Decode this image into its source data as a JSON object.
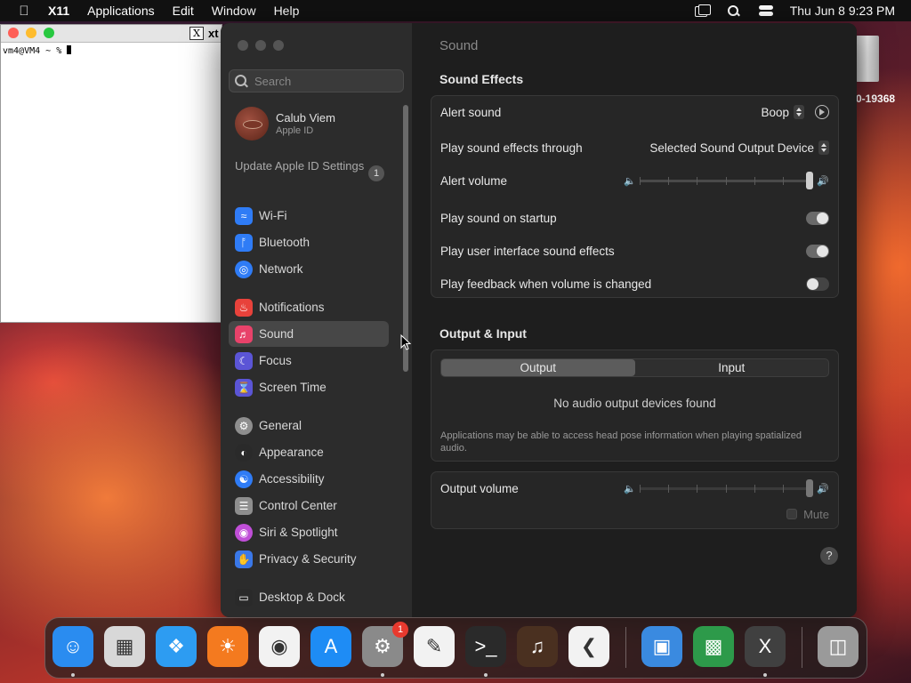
{
  "menubar": {
    "app_name": "X11",
    "menus": [
      "Applications",
      "Edit",
      "Window",
      "Help"
    ],
    "datetime": "Thu Jun 8  9:23 PM"
  },
  "xterm": {
    "title": "xt",
    "x_logo": "X",
    "prompt": "vm4@VM4 ~ % "
  },
  "desktop": {
    "disk_label": "0-19368"
  },
  "sidebar": {
    "search_placeholder": "Search",
    "account": {
      "name": "Calub Viem",
      "subtitle": "Apple ID"
    },
    "update_text": "Update Apple ID Settings",
    "update_badge": "1",
    "items": [
      {
        "label": "Wi-Fi",
        "icon": "wifi-icon",
        "color": "#2f7cf6"
      },
      {
        "label": "Bluetooth",
        "icon": "bluetooth-icon",
        "color": "#2f7cf6"
      },
      {
        "label": "Network",
        "icon": "globe-icon",
        "color": "#2f7cf6"
      },
      {
        "label": "Notifications",
        "icon": "bell-icon",
        "color": "#e8423b"
      },
      {
        "label": "Sound",
        "icon": "speaker-icon",
        "color": "#e8426a"
      },
      {
        "label": "Focus",
        "icon": "moon-icon",
        "color": "#5b55d6"
      },
      {
        "label": "Screen Time",
        "icon": "hourglass-icon",
        "color": "#5b55d6"
      },
      {
        "label": "General",
        "icon": "gear-icon",
        "color": "#8e8e8e"
      },
      {
        "label": "Appearance",
        "icon": "appearance-icon",
        "color": "#2a2a2a"
      },
      {
        "label": "Accessibility",
        "icon": "accessibility-icon",
        "color": "#2f7cf6"
      },
      {
        "label": "Control Center",
        "icon": "control-center-icon",
        "color": "#8e8e8e"
      },
      {
        "label": "Siri & Spotlight",
        "icon": "siri-icon",
        "color": "#c04fd8"
      },
      {
        "label": "Privacy & Security",
        "icon": "hand-icon",
        "color": "#3a78e8"
      },
      {
        "label": "Desktop & Dock",
        "icon": "dock-icon",
        "color": "#2a2a2a"
      }
    ],
    "selected": "Sound"
  },
  "content": {
    "page_title": "Sound",
    "sound_effects": {
      "section_title": "Sound Effects",
      "alert_sound_label": "Alert sound",
      "alert_sound_value": "Boop",
      "play_through_label": "Play sound effects through",
      "play_through_value": "Selected Sound Output Device",
      "alert_volume_label": "Alert volume",
      "alert_volume_level": 1.0,
      "startup_label": "Play sound on startup",
      "startup_on": true,
      "ui_effects_label": "Play user interface sound effects",
      "ui_effects_on": true,
      "feedback_label": "Play feedback when volume is changed",
      "feedback_on": false
    },
    "output_input": {
      "section_title": "Output & Input",
      "tabs": [
        "Output",
        "Input"
      ],
      "active_tab": "Output",
      "no_devices": "No audio output devices found",
      "note": "Applications may be able to access head pose information when playing spatialized audio."
    },
    "output_volume": {
      "label": "Output volume",
      "level": 1.0,
      "mute_label": "Mute"
    },
    "help": "?"
  },
  "dock": {
    "apps": [
      {
        "name": "Finder",
        "icon": "finder-icon",
        "running": true,
        "color": "#2a8cf0"
      },
      {
        "name": "Launchpad",
        "icon": "launchpad-icon",
        "running": false,
        "color": "#d8d8d8"
      },
      {
        "name": "Safari",
        "icon": "safari-icon",
        "running": false,
        "color": "#2d9cf2"
      },
      {
        "name": "Firefox",
        "icon": "firefox-icon",
        "running": false,
        "color": "#f47a1f"
      },
      {
        "name": "Chrome",
        "icon": "chrome-icon",
        "running": false,
        "color": "#f2f2f2"
      },
      {
        "name": "App Store",
        "icon": "app-store-icon",
        "running": false,
        "color": "#1e8cf5"
      },
      {
        "name": "System Settings",
        "icon": "system-settings-icon",
        "running": true,
        "badge": "1",
        "color": "#8a8a8a"
      },
      {
        "name": "TextEdit",
        "icon": "textedit-icon",
        "running": false,
        "color": "#f2f2f2"
      },
      {
        "name": "Terminal",
        "icon": "terminal-icon",
        "running": true,
        "color": "#2a2a2a"
      },
      {
        "name": "GarageBand",
        "icon": "garageband-icon",
        "running": false,
        "color": "#4a3020"
      },
      {
        "name": "VS Code",
        "icon": "vscode-icon",
        "running": false,
        "color": "#f2f2f2"
      },
      {
        "name": "Remote Desktop",
        "icon": "remote-desktop-icon",
        "running": false,
        "color": "#3a8ae0"
      },
      {
        "name": "Game Boy Emulator",
        "icon": "gameboy-icon",
        "running": false,
        "color": "#2d9a4a"
      },
      {
        "name": "X11",
        "icon": "x11-icon",
        "running": true,
        "color": "#404040"
      },
      {
        "name": "Trash",
        "icon": "trash-icon",
        "running": false,
        "color": "#9a9a9a"
      }
    ]
  }
}
